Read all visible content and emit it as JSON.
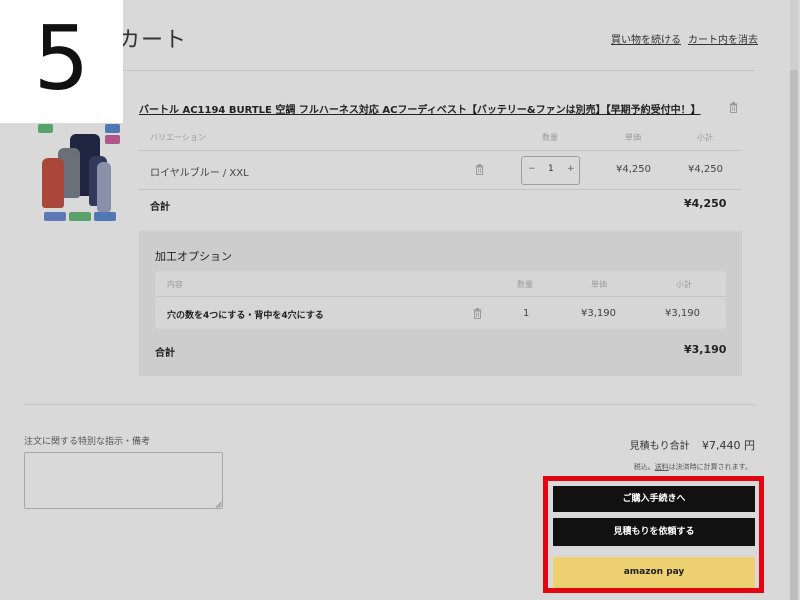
{
  "step": {
    "number": "5"
  },
  "header": {
    "title": "カート",
    "continue_shopping": "買い物を続ける",
    "clear_cart": "カート内を消去"
  },
  "product": {
    "name": "バートル AC1194 BURTLE 空調 フルハーネス対応 ACフーディベスト【バッテリー&ファンは別売】【早期予約受付中！】",
    "image_label": "product-photo",
    "table": {
      "headers": {
        "variation": "バリエーション",
        "quantity": "数量",
        "unit_price": "単価",
        "subtotal": "小計"
      },
      "row": {
        "variation": "ロイヤルブルー / XXL",
        "quantity": "1",
        "minus": "−",
        "plus": "+",
        "unit_price": "¥4,250",
        "subtotal": "¥4,250"
      },
      "total_label": "合計",
      "total_value": "¥4,250"
    }
  },
  "processing_options": {
    "title": "加工オプション",
    "headers": {
      "content": "内容",
      "quantity": "数量",
      "unit_price": "単価",
      "subtotal": "小計"
    },
    "row": {
      "content": "穴の数を4つにする・背中を4穴にする",
      "quantity": "1",
      "unit_price": "¥3,190",
      "subtotal": "¥3,190"
    },
    "total_label": "合計",
    "total_value": "¥3,190"
  },
  "notes": {
    "label": "注文に関する特別な指示・備考",
    "value": ""
  },
  "summary": {
    "estimate_label": "見積もり合計",
    "estimate_value": "¥7,440 円",
    "tax_note_prefix": "税込。",
    "tax_note_link": "送料",
    "tax_note_suffix": "は決済時に計算されます。"
  },
  "actions": {
    "checkout": "ご購入手続きへ",
    "request_quote": "見積もりを依頼する",
    "amazon_pay": "amazon pay"
  },
  "colors": {
    "page_bg": "#d9d9d9",
    "highlight": "#e20613",
    "dark_button": "#111111",
    "amazon_pay": "#edd06f"
  }
}
